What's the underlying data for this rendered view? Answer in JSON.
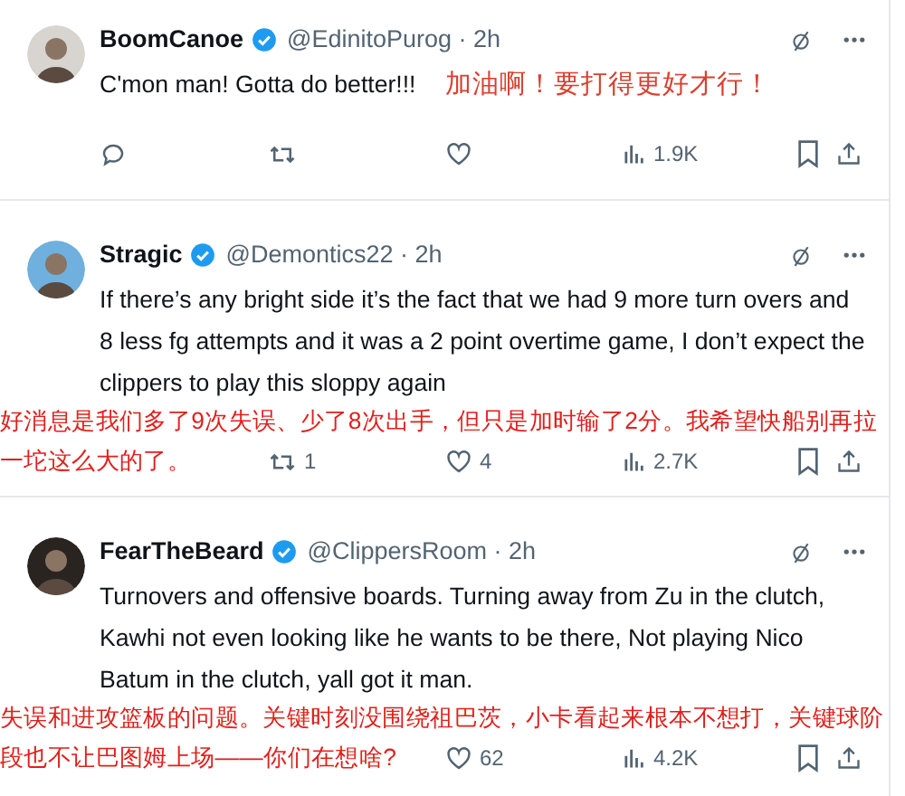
{
  "tweets": [
    {
      "kind": "inline_translation",
      "name": "BoomCanoe",
      "verified": true,
      "meta": "@EdinitoPurog · 2h",
      "text": "C'mon man! Gotta do better!!!",
      "translation_lines": [
        "加油啊！要打得更好才行！"
      ],
      "actions": [
        {
          "kind": "reply"
        },
        {
          "kind": "retweet"
        },
        {
          "kind": "like"
        },
        {
          "kind": "views",
          "count": "1.9K"
        },
        {
          "kind": "bookmark"
        },
        {
          "kind": "share"
        }
      ]
    },
    {
      "kind": "overlay_translation",
      "name": "Stragic",
      "verified": true,
      "meta": "@Demontics22 · 2h",
      "text": "If there’s any bright side it’s the fact that we had 9 more turn overs and 8 less fg attempts and it was a 2 point overtime game, I don’t expect the clippers to play this sloppy again",
      "translation_lines": [
        "好消息是我们多了9次失误、少了8次出手，但只是加时输了2分。我希望快船别再拉",
        "一坨这么大的了。"
      ],
      "actions": [
        {
          "kind": "retweet",
          "count": "1"
        },
        {
          "kind": "like",
          "count": "4"
        },
        {
          "kind": "views",
          "count": "2.7K"
        },
        {
          "kind": "bookmark"
        },
        {
          "kind": "share"
        }
      ]
    },
    {
      "kind": "overlay_translation",
      "name": "FearTheBeard",
      "verified": true,
      "meta": "@ClippersRoom · 2h",
      "text": "Turnovers and offensive boards. Turning away from Zu in the clutch, Kawhi not even looking like he wants to be there, Not playing Nico Batum in the clutch, yall got it man.",
      "translation_lines": [
        "失误和进攻篮板的问题。关键时刻没围绕祖巴茨，小卡看起来根本不想打，关键球阶",
        "段也不让巴图姆上场——你们在想啥?"
      ],
      "actions": [
        {
          "kind": "like",
          "count": "62"
        },
        {
          "kind": "views",
          "count": "4.2K"
        },
        {
          "kind": "bookmark"
        },
        {
          "kind": "share"
        }
      ]
    }
  ]
}
